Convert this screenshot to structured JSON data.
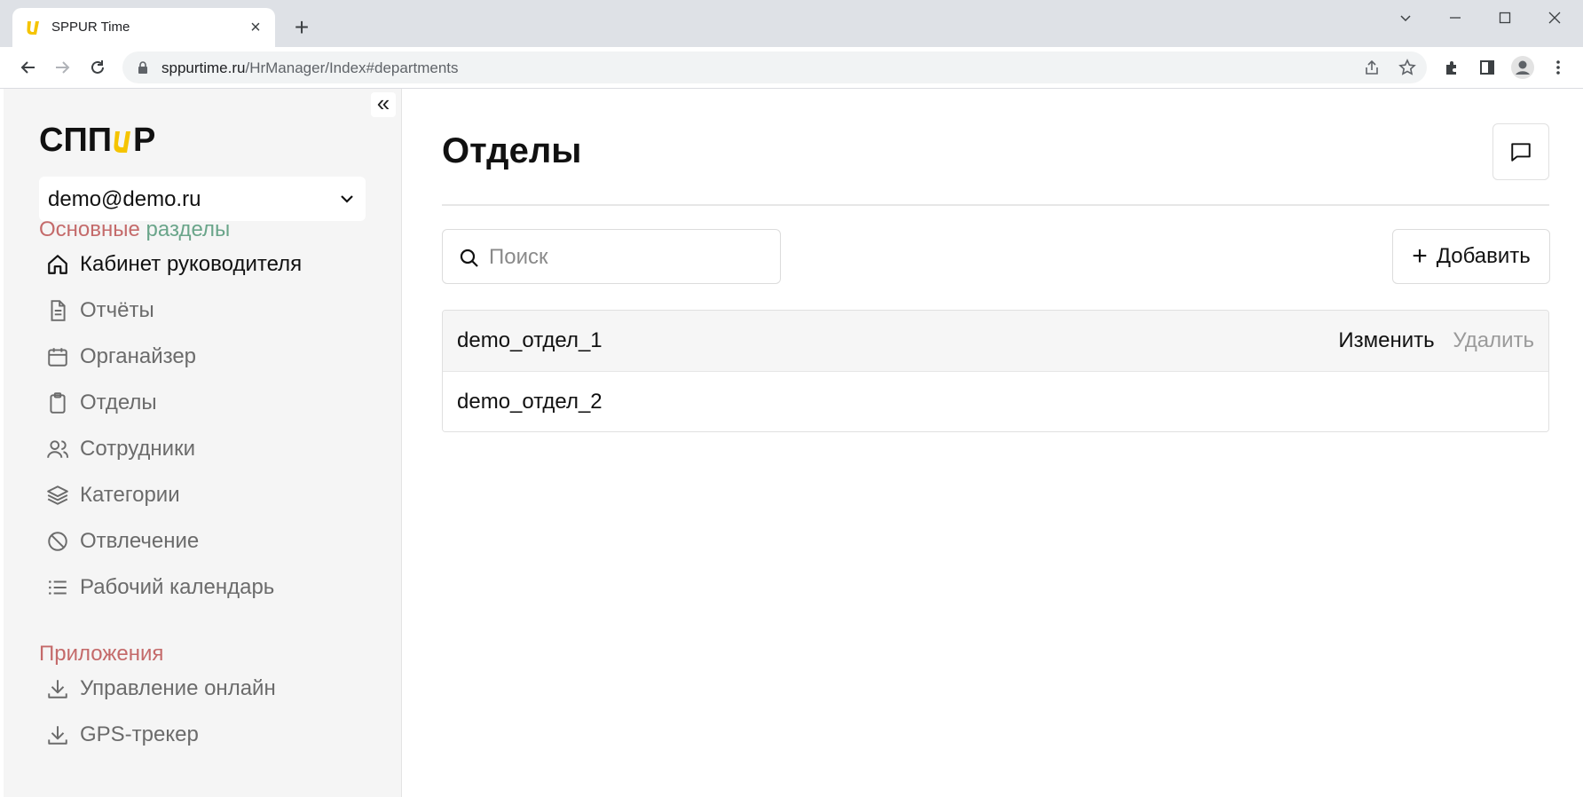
{
  "browser": {
    "tab_title": "SPPUR Time",
    "tab_close": "×",
    "new_tab": "+",
    "url_host": "sppurtime.ru",
    "url_path": "/HrManager/Index#departments"
  },
  "sidebar": {
    "collapse_glyph": "«",
    "account": "demo@demo.ru",
    "section_main_part1": "Основные",
    "section_main_part2": " разделы",
    "items": [
      {
        "label": "Кабинет руководителя",
        "icon": "home-icon"
      },
      {
        "label": "Отчёты",
        "icon": "document-icon"
      },
      {
        "label": "Органайзер",
        "icon": "calendar-icon"
      },
      {
        "label": "Отделы",
        "icon": "clipboard-icon"
      },
      {
        "label": "Сотрудники",
        "icon": "users-icon"
      },
      {
        "label": "Категории",
        "icon": "layers-icon"
      },
      {
        "label": "Отвлечение",
        "icon": "ban-icon"
      },
      {
        "label": "Рабочий календарь",
        "icon": "list-icon"
      }
    ],
    "section_apps": "Приложения",
    "apps": [
      {
        "label": "Управление онлайн",
        "icon": "download-icon"
      },
      {
        "label": "GPS-трекер",
        "icon": "download-icon"
      }
    ]
  },
  "main": {
    "title": "Отделы",
    "search_placeholder": "Поиск",
    "add_label": "Добавить",
    "departments": [
      {
        "name": "demo_отдел_1",
        "edit": "Изменить",
        "delete": "Удалить"
      },
      {
        "name": "demo_отдел_2"
      }
    ]
  },
  "colors": {
    "accent_yellow": "#f5c400",
    "section_red": "#c46a6a",
    "section_green": "#6aa58a"
  }
}
